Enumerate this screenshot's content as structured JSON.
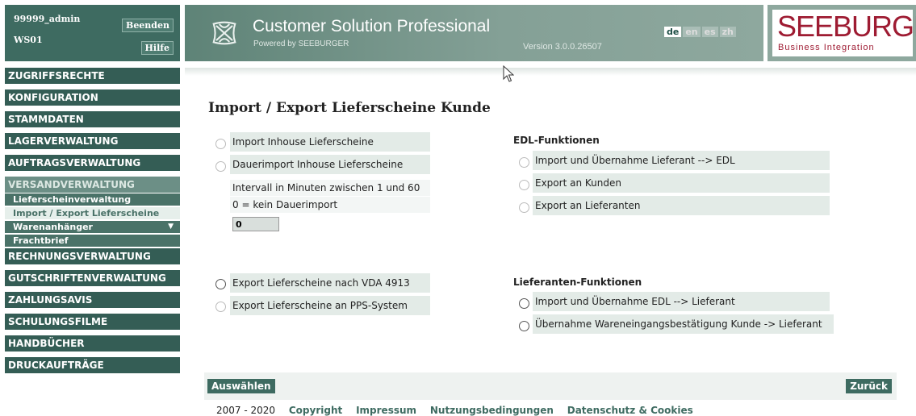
{
  "user": {
    "name": "99999_admin",
    "client": "WS01",
    "logout_label": "Beenden",
    "help_label": "Hilfe"
  },
  "banner": {
    "title": "Customer Solution Professional",
    "subtitle": "Powered by SEEBURGER",
    "version": "Version 3.0.0.26507",
    "languages": [
      "de",
      "en",
      "es",
      "zh"
    ],
    "active_language": "de",
    "brand_line1": "SEEBURGER",
    "brand_line2": "Business Integration",
    "brand_color": "#9e1b32"
  },
  "sidebar": {
    "items": [
      {
        "label": "ZUGRIFFSRECHTE"
      },
      {
        "label": "KONFIGURATION"
      },
      {
        "label": "STAMMDATEN"
      },
      {
        "label": "LAGERVERWALTUNG"
      },
      {
        "label": "AUFTRAGSVERWALTUNG"
      },
      {
        "label": "VERSANDVERWALTUNG"
      },
      {
        "label": "RECHNUNGSVERWALTUNG"
      },
      {
        "label": "GUTSCHRIFTENVERWALTUNG"
      },
      {
        "label": "ZAHLUNGSAVIS"
      },
      {
        "label": "SCHULUNGSFILME"
      },
      {
        "label": "HANDBÜCHER"
      },
      {
        "label": "DRUCKAUFTRÄGE"
      }
    ],
    "active_item": "VERSANDVERWALTUNG",
    "subitems": [
      {
        "label": "Lieferscheinverwaltung"
      },
      {
        "label": "Import / Export Lieferscheine"
      },
      {
        "label": "Warenanhänger"
      },
      {
        "label": "Frachtbrief"
      }
    ]
  },
  "main": {
    "title": "Import / Export Lieferscheine Kunde",
    "left_options_top": [
      {
        "label": "Import Inhouse Lieferscheine"
      },
      {
        "label": "Dauerimport Inhouse Lieferscheine"
      }
    ],
    "interval_hint": "Intervall in Minuten zwischen 1 und 60",
    "interval_hint2": "0 = kein Dauerimport",
    "interval_value": "0",
    "left_options_bottom": [
      {
        "label": "Export Lieferscheine nach VDA 4913"
      },
      {
        "label": "Export Lieferscheine an PPS-System"
      }
    ],
    "edl_heading": "EDL-Funktionen",
    "edl_options": [
      {
        "label": "Import und Übernahme Lieferant --> EDL"
      },
      {
        "label": "Export an Kunden"
      },
      {
        "label": "Export an Lieferanten"
      }
    ],
    "supplier_heading": "Lieferanten-Funktionen",
    "supplier_options": [
      {
        "label": "Import und Übernahme EDL --> Lieferant"
      },
      {
        "label": "Übernahme Wareneingangsbestätigung Kunde -> Lieferant"
      }
    ],
    "select_label": "Auswählen",
    "back_label": "Zurück"
  },
  "footer": {
    "years": "2007 - 2020",
    "links": [
      "Copyright",
      "Impressum",
      "Nutzungsbedingungen",
      "Datenschutz & Cookies"
    ]
  },
  "colors": {
    "nav_bg": "#345d55",
    "accent": "#3e6b61",
    "option_bg": "#e3ebe7"
  }
}
